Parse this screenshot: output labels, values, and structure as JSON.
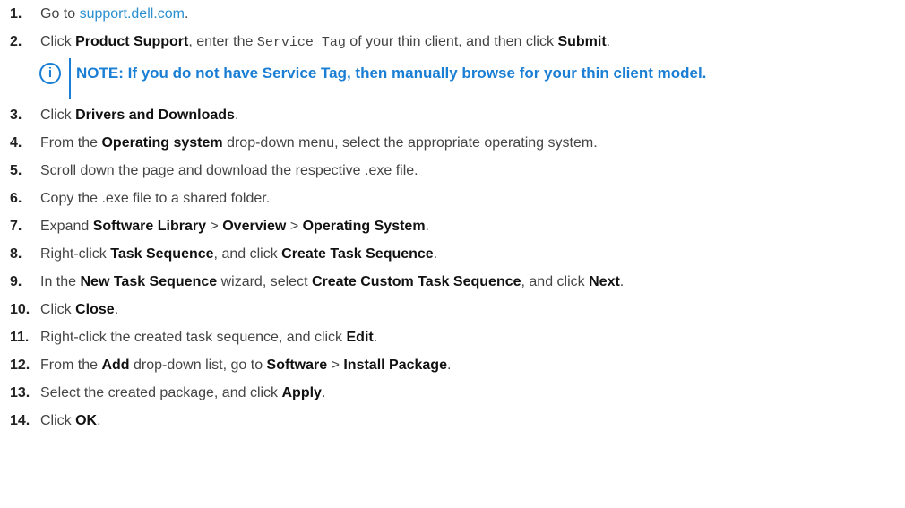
{
  "steps": [
    {
      "num": "1.",
      "parts": [
        {
          "t": "Go to "
        },
        {
          "t": "support.dell.com",
          "s": "link"
        },
        {
          "t": "."
        }
      ]
    },
    {
      "num": "2.",
      "parts": [
        {
          "t": "Click "
        },
        {
          "t": "Product Support",
          "s": "b"
        },
        {
          "t": ", enter the "
        },
        {
          "t": "Service Tag",
          "s": "mono"
        },
        {
          "t": " of your thin client, and then click "
        },
        {
          "t": "Submit",
          "s": "b"
        },
        {
          "t": "."
        }
      ]
    },
    {
      "num": "3.",
      "parts": [
        {
          "t": "Click "
        },
        {
          "t": "Drivers and Downloads",
          "s": "b"
        },
        {
          "t": "."
        }
      ]
    },
    {
      "num": "4.",
      "parts": [
        {
          "t": "From the "
        },
        {
          "t": "Operating system",
          "s": "b"
        },
        {
          "t": " drop-down menu, select the appropriate operating system."
        }
      ]
    },
    {
      "num": "5.",
      "parts": [
        {
          "t": "Scroll down the page and download the respective .exe file."
        }
      ]
    },
    {
      "num": "6.",
      "parts": [
        {
          "t": "Copy the .exe file to a shared folder."
        }
      ]
    },
    {
      "num": "7.",
      "parts": [
        {
          "t": "Expand "
        },
        {
          "t": "Software Library",
          "s": "b"
        },
        {
          "t": " > "
        },
        {
          "t": "Overview",
          "s": "b"
        },
        {
          "t": " > "
        },
        {
          "t": "Operating System",
          "s": "b"
        },
        {
          "t": "."
        }
      ]
    },
    {
      "num": "8.",
      "parts": [
        {
          "t": "Right-click "
        },
        {
          "t": "Task Sequence",
          "s": "b"
        },
        {
          "t": ", and click "
        },
        {
          "t": "Create Task Sequence",
          "s": "b"
        },
        {
          "t": "."
        }
      ]
    },
    {
      "num": "9.",
      "parts": [
        {
          "t": "In the "
        },
        {
          "t": "New Task Sequence",
          "s": "b"
        },
        {
          "t": " wizard, select "
        },
        {
          "t": "Create Custom Task Sequence",
          "s": "b"
        },
        {
          "t": ", and click "
        },
        {
          "t": "Next",
          "s": "b"
        },
        {
          "t": "."
        }
      ]
    },
    {
      "num": "10.",
      "parts": [
        {
          "t": "Click "
        },
        {
          "t": "Close",
          "s": "b"
        },
        {
          "t": "."
        }
      ]
    },
    {
      "num": "11.",
      "parts": [
        {
          "t": "Right-click the created task sequence, and click "
        },
        {
          "t": "Edit",
          "s": "b"
        },
        {
          "t": "."
        }
      ]
    },
    {
      "num": "12.",
      "parts": [
        {
          "t": "From the "
        },
        {
          "t": "Add",
          "s": "b"
        },
        {
          "t": " drop-down list, go to "
        },
        {
          "t": "Software",
          "s": "b"
        },
        {
          "t": " > "
        },
        {
          "t": "Install Package",
          "s": "b"
        },
        {
          "t": "."
        }
      ]
    },
    {
      "num": "13.",
      "parts": [
        {
          "t": "Select the created package, and click "
        },
        {
          "t": "Apply",
          "s": "b"
        },
        {
          "t": "."
        }
      ]
    },
    {
      "num": "14.",
      "parts": [
        {
          "t": "Click "
        },
        {
          "t": "OK",
          "s": "b"
        },
        {
          "t": "."
        }
      ]
    }
  ],
  "note": {
    "after_step": 2,
    "icon": "info-icon",
    "icon_glyph": "i",
    "text": "NOTE: If you do not have Service Tag, then manually browse for your thin client model."
  },
  "colors": {
    "text": "#444444",
    "link": "#2a8fd0",
    "note": "#1a7fd4",
    "number": "#222222"
  }
}
